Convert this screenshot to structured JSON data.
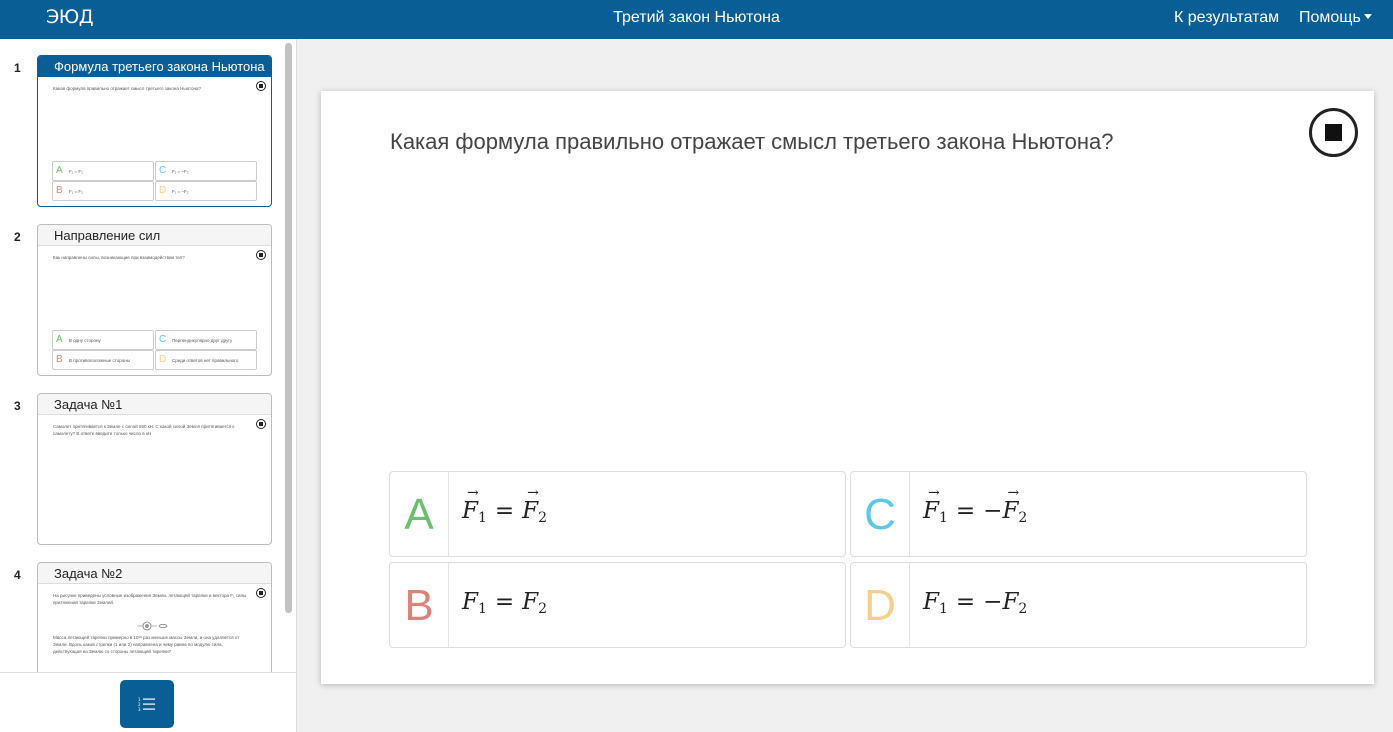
{
  "header": {
    "logo": "ЭЮД",
    "title": "Третий закон Ньютона",
    "results_link": "К результатам",
    "help_menu": "Помощь"
  },
  "sidebar": {
    "slides": [
      {
        "number": "1",
        "title": "Формула третьего закона Ньютона",
        "question": "Какая формула правильно отражает смысл третьего закона Ньютона?",
        "options": [
          {
            "letter": "A",
            "text": "F₁ = F₂"
          },
          {
            "letter": "C",
            "text": "F₁ = −F₂"
          },
          {
            "letter": "B",
            "text": "F₁ = F₂"
          },
          {
            "letter": "D",
            "text": "F₁ = −F₂"
          }
        ]
      },
      {
        "number": "2",
        "title": "Направление сил",
        "question": "Как направлены силы, возникающие при взаимодействии тел?",
        "options": [
          {
            "letter": "A",
            "text": "В одну сторону"
          },
          {
            "letter": "C",
            "text": "Перпендикулярно друг другу"
          },
          {
            "letter": "B",
            "text": "В противоположные стороны"
          },
          {
            "letter": "D",
            "text": "Среди ответов нет правильного"
          }
        ]
      },
      {
        "number": "3",
        "title": "Задача №1",
        "question": "Самолет притягивается к Земле с силой 550 кН. С какой силой Земля притягивается к самолету? В ответе введите только число в кН"
      },
      {
        "number": "4",
        "title": "Задача №2",
        "question": "На рисунке приведены условные изображения Земли, летающей тарелки и вектора F₁ силы притяжения тарелки Землей.",
        "question_2": "Масса летающей тарелки примерно в 10¹⁸ раз меньше массы Земли, и она удаляется от Земли. Вдоль какой стрелки (1 или 2) направлена и чему равна по модулю сила, действующая на Землю со стороны летающей тарелки?"
      }
    ]
  },
  "main": {
    "question": "Какая формула правильно отражает смысл третьего закона Ньютона?",
    "answers": [
      {
        "letter": "A",
        "lhs": "F",
        "lhs_sub": "1",
        "op": "=",
        "neg": "",
        "rhs": "F",
        "rhs_sub": "2",
        "vector": true,
        "color": "#6cc06c"
      },
      {
        "letter": "C",
        "lhs": "F",
        "lhs_sub": "1",
        "op": "=",
        "neg": "−",
        "rhs": "F",
        "rhs_sub": "2",
        "vector": true,
        "color": "#5bc8e8"
      },
      {
        "letter": "B",
        "lhs": "F",
        "lhs_sub": "1",
        "op": "=",
        "neg": "",
        "rhs": "F",
        "rhs_sub": "2",
        "vector": false,
        "color": "#d9837a"
      },
      {
        "letter": "D",
        "lhs": "F",
        "lhs_sub": "1",
        "op": "=",
        "neg": "−",
        "rhs": "F",
        "rhs_sub": "2",
        "vector": false,
        "color": "#f5cf8c"
      }
    ]
  },
  "icons": {
    "stop": "stop-icon",
    "toc": "list-icon"
  },
  "colors": {
    "header": "#0a5e96"
  }
}
